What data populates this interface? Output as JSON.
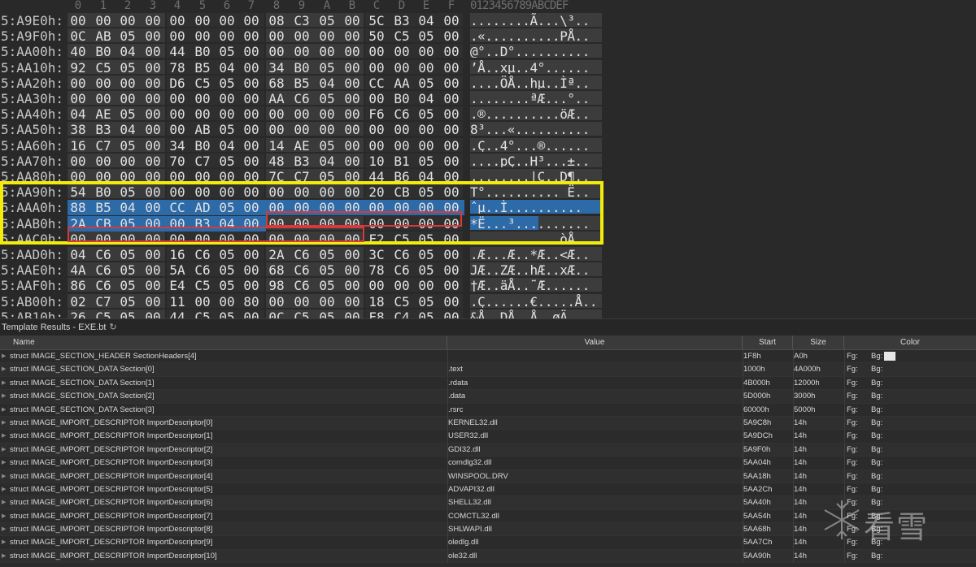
{
  "hex": {
    "column_headers": [
      "0",
      "1",
      "2",
      "3",
      "4",
      "5",
      "6",
      "7",
      "8",
      "9",
      "A",
      "B",
      "C",
      "D",
      "E",
      "F"
    ],
    "ascii_header": "0123456789ABCDEF",
    "rows": [
      {
        "addr": "5:A9E0h:",
        "bytes": [
          "00",
          "00",
          "00",
          "00",
          "00",
          "00",
          "00",
          "00",
          "08",
          "C3",
          "05",
          "00",
          "5C",
          "B3",
          "04",
          "00"
        ],
        "ascii": "........Ã...\\³.."
      },
      {
        "addr": "5:A9F0h:",
        "bytes": [
          "0C",
          "AB",
          "05",
          "00",
          "00",
          "00",
          "00",
          "00",
          "00",
          "00",
          "00",
          "00",
          "50",
          "C5",
          "05",
          "00"
        ],
        "ascii": ".«..........PÅ.."
      },
      {
        "addr": "5:AA00h:",
        "bytes": [
          "40",
          "B0",
          "04",
          "00",
          "44",
          "B0",
          "05",
          "00",
          "00",
          "00",
          "00",
          "00",
          "00",
          "00",
          "00",
          "00"
        ],
        "ascii": "@°..D°.........."
      },
      {
        "addr": "5:AA10h:",
        "bytes": [
          "92",
          "C5",
          "05",
          "00",
          "78",
          "B5",
          "04",
          "00",
          "34",
          "B0",
          "05",
          "00",
          "00",
          "00",
          "00",
          "00"
        ],
        "ascii": "’Å..xµ..4°......"
      },
      {
        "addr": "5:AA20h:",
        "bytes": [
          "00",
          "00",
          "00",
          "00",
          "D6",
          "C5",
          "05",
          "00",
          "68",
          "B5",
          "04",
          "00",
          "CC",
          "AA",
          "05",
          "00"
        ],
        "ascii": "....ÖÅ..hµ..Ìª.."
      },
      {
        "addr": "5:AA30h:",
        "bytes": [
          "00",
          "00",
          "00",
          "00",
          "00",
          "00",
          "00",
          "00",
          "AA",
          "C6",
          "05",
          "00",
          "00",
          "B0",
          "04",
          "00"
        ],
        "ascii": "........ªÆ...°.."
      },
      {
        "addr": "5:AA40h:",
        "bytes": [
          "04",
          "AE",
          "05",
          "00",
          "00",
          "00",
          "00",
          "00",
          "00",
          "00",
          "00",
          "00",
          "F6",
          "C6",
          "05",
          "00"
        ],
        "ascii": ".®..........öÆ.."
      },
      {
        "addr": "5:AA50h:",
        "bytes": [
          "38",
          "B3",
          "04",
          "00",
          "00",
          "AB",
          "05",
          "00",
          "00",
          "00",
          "00",
          "00",
          "00",
          "00",
          "00",
          "00"
        ],
        "ascii": "8³...«.........."
      },
      {
        "addr": "5:AA60h:",
        "bytes": [
          "16",
          "C7",
          "05",
          "00",
          "34",
          "B0",
          "04",
          "00",
          "14",
          "AE",
          "05",
          "00",
          "00",
          "00",
          "00",
          "00"
        ],
        "ascii": ".Ç..4°...®......"
      },
      {
        "addr": "5:AA70h:",
        "bytes": [
          "00",
          "00",
          "00",
          "00",
          "70",
          "C7",
          "05",
          "00",
          "48",
          "B3",
          "04",
          "00",
          "10",
          "B1",
          "05",
          "00"
        ],
        "ascii": "....pÇ..H³...±.."
      },
      {
        "addr": "5:AA80h:",
        "bytes": [
          "00",
          "00",
          "00",
          "00",
          "00",
          "00",
          "00",
          "00",
          "7C",
          "C7",
          "05",
          "00",
          "44",
          "B6",
          "04",
          "00"
        ],
        "ascii": "........|Ç..D¶.."
      },
      {
        "addr": "5:AA90h:",
        "bytes": [
          "54",
          "B0",
          "05",
          "00",
          "00",
          "00",
          "00",
          "00",
          "00",
          "00",
          "00",
          "00",
          "20",
          "CB",
          "05",
          "00"
        ],
        "ascii": "T°.......... Ë.."
      },
      {
        "addr": "5:AAA0h:",
        "bytes": [
          "88",
          "B5",
          "04",
          "00",
          "CC",
          "AD",
          "05",
          "00",
          "00",
          "00",
          "00",
          "00",
          "00",
          "00",
          "00",
          "00"
        ],
        "ascii": "ˆµ..Ì­.........."
      },
      {
        "addr": "5:AAB0h:",
        "bytes": [
          "2A",
          "CB",
          "05",
          "00",
          "00",
          "B3",
          "04",
          "00",
          "00",
          "00",
          "00",
          "00",
          "00",
          "00",
          "00",
          "00"
        ],
        "ascii": "*Ë...³.........."
      },
      {
        "addr": "5:AAC0h:",
        "bytes": [
          "00",
          "00",
          "00",
          "00",
          "00",
          "00",
          "00",
          "00",
          "00",
          "00",
          "00",
          "00",
          "F2",
          "C5",
          "05",
          "00"
        ],
        "ascii": "............òÅ.."
      },
      {
        "addr": "5:AAD0h:",
        "bytes": [
          "04",
          "C6",
          "05",
          "00",
          "16",
          "C6",
          "05",
          "00",
          "2A",
          "C6",
          "05",
          "00",
          "3C",
          "C6",
          "05",
          "00"
        ],
        "ascii": ".Æ...Æ..*Æ..<Æ.."
      },
      {
        "addr": "5:AAE0h:",
        "bytes": [
          "4A",
          "C6",
          "05",
          "00",
          "5A",
          "C6",
          "05",
          "00",
          "68",
          "C6",
          "05",
          "00",
          "78",
          "C6",
          "05",
          "00"
        ],
        "ascii": "JÆ..ZÆ..hÆ..xÆ.."
      },
      {
        "addr": "5:AAF0h:",
        "bytes": [
          "86",
          "C6",
          "05",
          "00",
          "E4",
          "C5",
          "05",
          "00",
          "98",
          "C6",
          "05",
          "00",
          "00",
          "00",
          "00",
          "00"
        ],
        "ascii": "†Æ..äÅ..˜Æ......"
      },
      {
        "addr": "5:AB00h:",
        "bytes": [
          "02",
          "C7",
          "05",
          "00",
          "11",
          "00",
          "00",
          "80",
          "00",
          "00",
          "00",
          "00",
          "18",
          "C5",
          "05",
          "00"
        ],
        "ascii": ".Ç......€.....Å.."
      },
      {
        "addr": "5:AB10h:",
        "bytes": [
          "26",
          "C5",
          "05",
          "00",
          "44",
          "C5",
          "05",
          "00",
          "0C",
          "C5",
          "05",
          "00",
          "F8",
          "C4",
          "05",
          "00"
        ],
        "ascii": "&Å..DÅ..Å..øÄ.."
      }
    ]
  },
  "template": {
    "title": "Template Results - EXE.bt",
    "headers": {
      "name": "Name",
      "value": "Value",
      "start": "Start",
      "size": "Size",
      "color": "Color"
    },
    "fg_label": "Fg:",
    "bg_label": "Bg:",
    "rows": [
      {
        "name": "struct IMAGE_SECTION_HEADER SectionHeaders[4]",
        "value": "",
        "start": "1F8h",
        "size": "A0h"
      },
      {
        "name": "struct IMAGE_SECTION_DATA Section[0]",
        "value": ".text",
        "start": "1000h",
        "size": "4A000h"
      },
      {
        "name": "struct IMAGE_SECTION_DATA Section[1]",
        "value": ".rdata",
        "start": "4B000h",
        "size": "12000h"
      },
      {
        "name": "struct IMAGE_SECTION_DATA Section[2]",
        "value": ".data",
        "start": "5D000h",
        "size": "3000h"
      },
      {
        "name": "struct IMAGE_SECTION_DATA Section[3]",
        "value": ".rsrc",
        "start": "60000h",
        "size": "5000h"
      },
      {
        "name": "struct IMAGE_IMPORT_DESCRIPTOR ImportDescriptor[0]",
        "value": "KERNEL32.dll",
        "start": "5A9C8h",
        "size": "14h"
      },
      {
        "name": "struct IMAGE_IMPORT_DESCRIPTOR ImportDescriptor[1]",
        "value": "USER32.dll",
        "start": "5A9DCh",
        "size": "14h"
      },
      {
        "name": "struct IMAGE_IMPORT_DESCRIPTOR ImportDescriptor[2]",
        "value": "GDI32.dll",
        "start": "5A9F0h",
        "size": "14h"
      },
      {
        "name": "struct IMAGE_IMPORT_DESCRIPTOR ImportDescriptor[3]",
        "value": "comdlg32.dll",
        "start": "5AA04h",
        "size": "14h"
      },
      {
        "name": "struct IMAGE_IMPORT_DESCRIPTOR ImportDescriptor[4]",
        "value": "WINSPOOL.DRV",
        "start": "5AA18h",
        "size": "14h"
      },
      {
        "name": "struct IMAGE_IMPORT_DESCRIPTOR ImportDescriptor[5]",
        "value": "ADVAPI32.dll",
        "start": "5AA2Ch",
        "size": "14h"
      },
      {
        "name": "struct IMAGE_IMPORT_DESCRIPTOR ImportDescriptor[6]",
        "value": "SHELL32.dll",
        "start": "5AA40h",
        "size": "14h"
      },
      {
        "name": "struct IMAGE_IMPORT_DESCRIPTOR ImportDescriptor[7]",
        "value": "COMCTL32.dll",
        "start": "5AA54h",
        "size": "14h"
      },
      {
        "name": "struct IMAGE_IMPORT_DESCRIPTOR ImportDescriptor[8]",
        "value": "SHLWAPI.dll",
        "start": "5AA68h",
        "size": "14h"
      },
      {
        "name": "struct IMAGE_IMPORT_DESCRIPTOR ImportDescriptor[9]",
        "value": "oledlg.dll",
        "start": "5AA7Ch",
        "size": "14h"
      },
      {
        "name": "struct IMAGE_IMPORT_DESCRIPTOR ImportDescriptor[10]",
        "value": "ole32.dll",
        "start": "5AA90h",
        "size": "14h"
      }
    ]
  },
  "watermark": {
    "text": "看雪"
  },
  "colors": {
    "selection": "#2d6aa8",
    "highlight_yellow": "#f3ec0a",
    "highlight_red": "#d63a3a"
  }
}
